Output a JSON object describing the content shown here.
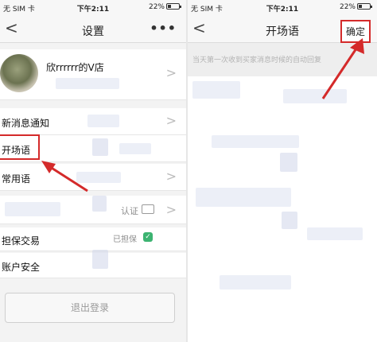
{
  "left": {
    "status": {
      "carrier": "无 SIM 卡",
      "time": "下午2:11",
      "battery": "22%"
    },
    "nav": {
      "title": "设置",
      "back": "<",
      "more": "•••"
    },
    "profile": {
      "name": "欣rrrrrr的V店"
    },
    "items": {
      "notify": "新消息通知",
      "greeting": "开场语",
      "phrases": "常用语",
      "certify": "认证",
      "escrow": "担保交易",
      "escrow_status": "已担保",
      "security": "账户安全"
    },
    "logout": "退出登录"
  },
  "right": {
    "status": {
      "carrier": "无 SIM 卡",
      "time": "下午2:11",
      "battery": "22%"
    },
    "nav": {
      "title": "开场语",
      "back": "<",
      "confirm": "确定"
    },
    "hint": "当天第一次收到买家消息时候的自动回复"
  },
  "colors": {
    "highlight": "#d42a2a",
    "green_check": "#3cb371"
  }
}
